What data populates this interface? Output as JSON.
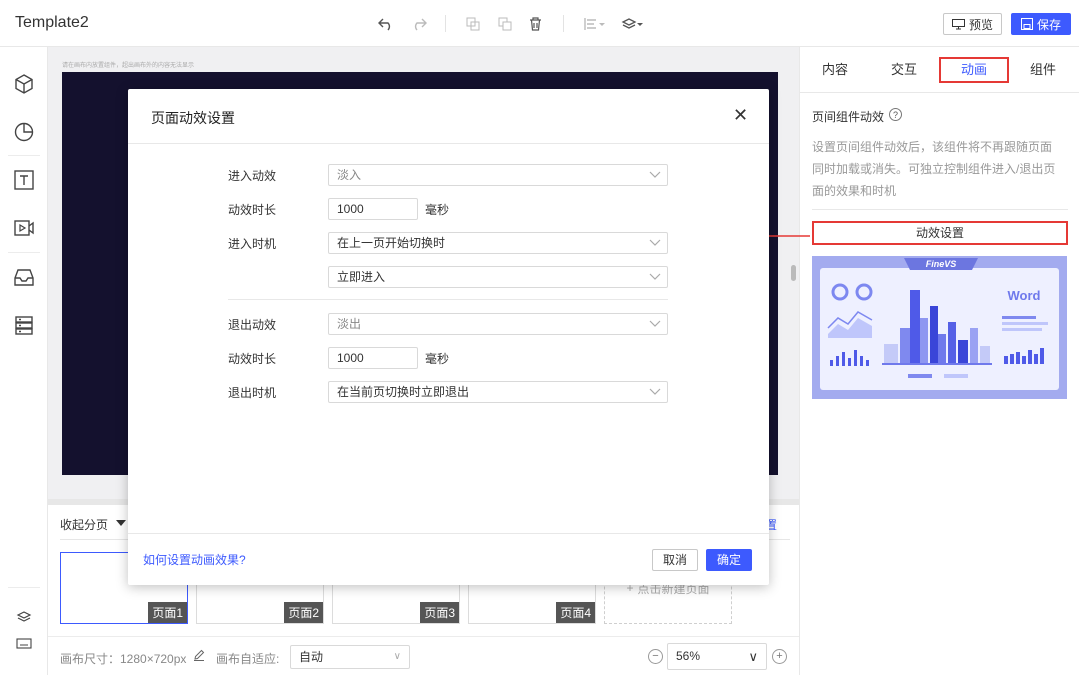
{
  "app": {
    "title": "Template2"
  },
  "toolbar": {
    "preview_label": "预览",
    "save_label": "保存"
  },
  "canvas": {
    "hint": "请在画布内放置组件，超出画布外的内容无法显示"
  },
  "pages": {
    "collapse_label": "收起分页",
    "settings_link": "置",
    "thumbnails": [
      "页面1",
      "页面2",
      "页面3",
      "页面4"
    ],
    "add_label": "点击新建页面"
  },
  "status": {
    "size_label": "画布尺寸：1280×720px",
    "adapt_label": "画布自适应:",
    "adapt_value": "自动",
    "zoom_value": "56%"
  },
  "right_panel": {
    "tabs": [
      "内容",
      "交互",
      "动画",
      "组件"
    ],
    "active_tab": "动画",
    "section_title": "页间组件动效",
    "description": "设置页间组件动效后，该组件将不再跟随页面同时加载或消失。可独立控制组件进入/退出页面的效果和时机",
    "anim_button": "动效设置",
    "preview_brand": "FineVS",
    "preview_word": "Word"
  },
  "modal": {
    "title": "页面动效设置",
    "enter_effect_label": "进入动效",
    "enter_effect_value": "淡入",
    "enter_duration_label": "动效时长",
    "enter_duration_value": "1000",
    "unit": "毫秒",
    "enter_timing_label": "进入时机",
    "enter_timing_value": "在上一页开始切换时",
    "enter_timing_sub_value": "立即进入",
    "exit_effect_label": "退出动效",
    "exit_effect_value": "淡出",
    "exit_duration_label": "动效时长",
    "exit_duration_value": "1000",
    "exit_timing_label": "退出时机",
    "exit_timing_value": "在当前页切换时立即退出",
    "help_link": "如何设置动画效果?",
    "cancel_label": "取消",
    "ok_label": "确定"
  },
  "colors": {
    "accent": "#3d5afe",
    "annotation": "#e53935",
    "canvas_bg": "#14112e"
  }
}
